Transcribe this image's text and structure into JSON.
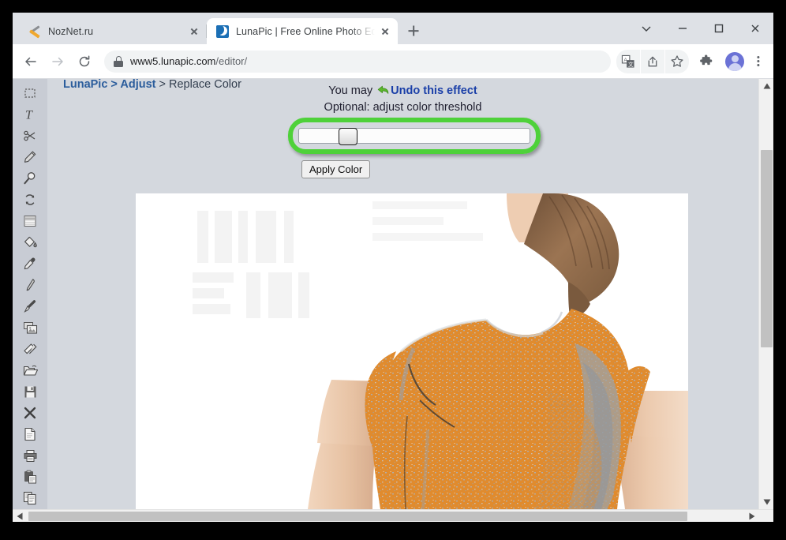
{
  "browser": {
    "tabs": [
      {
        "title": "NozNet.ru",
        "favicon": "tools-icon",
        "active": false
      },
      {
        "title": "LunaPic | Free Online Photo Editor",
        "favicon": "lunapic-moon-icon",
        "active": true
      }
    ],
    "new_tab_label": "+",
    "window_controls": [
      "chevron-down-icon",
      "minimize-icon",
      "maximize-icon",
      "close-icon"
    ],
    "nav": {
      "back": "back-arrow-icon",
      "forward": "forward-arrow-icon",
      "reload": "reload-icon"
    },
    "omnibox": {
      "lock": "lock-icon",
      "host": "www5.lunapic.com",
      "path": "/editor/",
      "full_url": "www5.lunapic.com/editor/"
    },
    "actions": [
      "translate-icon",
      "share-icon",
      "bookmark-star-icon",
      "extensions-puzzle-icon",
      "profile-avatar",
      "three-dot-menu-icon"
    ]
  },
  "page": {
    "breadcrumb": {
      "app": "LunaPic > Adjust",
      "current": " > Replace Color"
    },
    "instructions": {
      "line1_prefix": "You may ",
      "undo_icon": "undo-arrow-icon",
      "undo_link": "Undo this effect",
      "line2": "Optional: adjust color threshold"
    },
    "slider": {
      "name": "color-threshold-slider",
      "value_percent": 18,
      "annotated": true,
      "annotation_color": "#4ed13a"
    },
    "apply_button_label": "Apply Color",
    "canvas": {
      "description": "Photo of woman from behind wearing a t-shirt recolored orange",
      "shirt_color": "#e08b2e",
      "shadow_color": "#9aa0a6",
      "skin_color": "#e8c3a5",
      "hair_color": "#8d6a4e",
      "background": "#ffffff"
    },
    "toolbar_tools": [
      "marquee-select-icon",
      "text-tool-icon",
      "scissors-cut-icon",
      "pencil-icon",
      "magnifier-zoom-icon",
      "rotate-refresh-icon",
      "gradient-fade-icon",
      "paint-bucket-icon",
      "eyedropper-icon",
      "calligraphy-pen-icon",
      "paintbrush-icon",
      "layers-images-icon",
      "eraser-icon",
      "open-folder-icon",
      "save-floppy-icon",
      "close-x-icon",
      "new-document-icon",
      "printer-icon",
      "clipboard-paste-icon",
      "copy-icon"
    ],
    "scrollbars": {
      "vertical": {
        "thumb_top_percent": 17,
        "thumb_height_percent": 46
      },
      "horizontal": {
        "thumb_left_percent": 2,
        "thumb_width_percent": 88
      }
    }
  }
}
